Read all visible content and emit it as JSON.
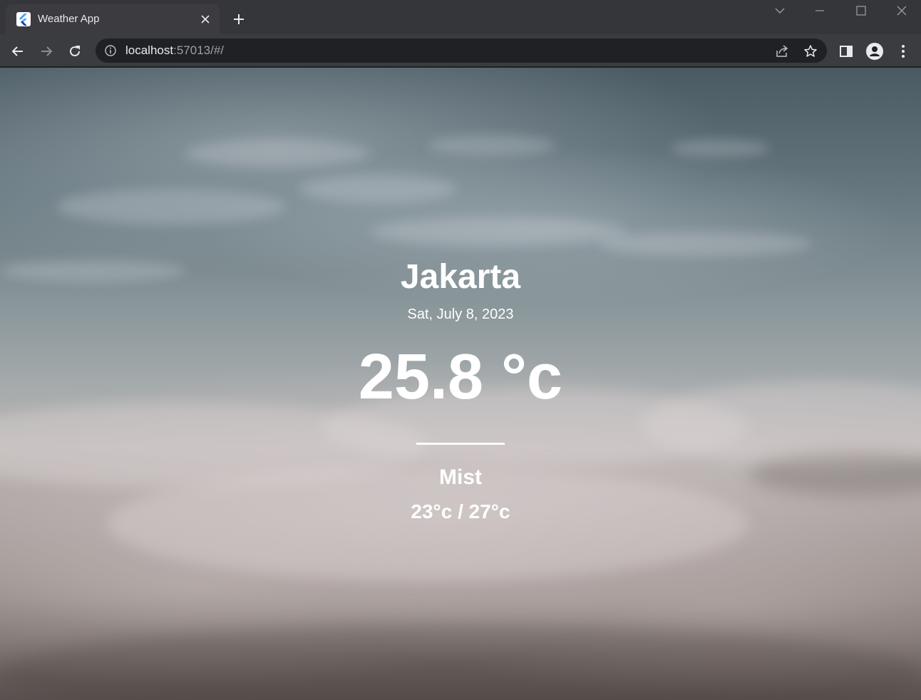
{
  "browser": {
    "tab_title": "Weather App",
    "url_host": "localhost",
    "url_rest": ":57013/#/"
  },
  "icons": {
    "favicon": "flutter-icon",
    "tab_close": "close-icon",
    "new_tab": "plus-icon",
    "back": "back-arrow-icon",
    "forward": "forward-arrow-icon",
    "reload": "reload-icon",
    "site_info": "info-icon",
    "share": "share-icon",
    "bookmark": "star-icon",
    "side_panel": "side-panel-icon",
    "profile": "profile-icon",
    "menu": "kebab-menu-icon"
  },
  "weather": {
    "city": "Jakarta",
    "date": "Sat, July 8, 2023",
    "temperature": "25.8 °c",
    "condition": "Mist",
    "range": "23°c / 27°c"
  }
}
